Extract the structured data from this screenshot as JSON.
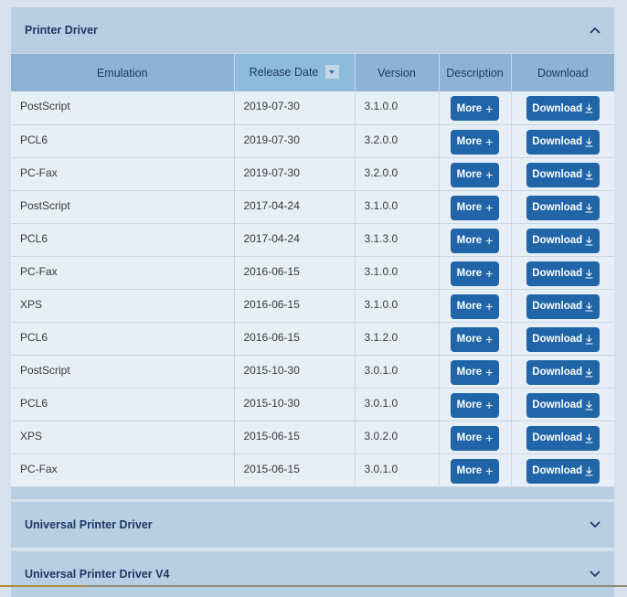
{
  "panels": [
    {
      "title": "Printer Driver",
      "expanded": true,
      "icon": "chevron-up-icon"
    },
    {
      "title": "Universal Printer Driver",
      "expanded": false,
      "icon": "chevron-down-icon"
    },
    {
      "title": "Universal Printer Driver V4",
      "expanded": false,
      "icon": "chevron-down-icon"
    }
  ],
  "table": {
    "columns": [
      "Emulation",
      "Release Date",
      "Version",
      "Description",
      "Download"
    ],
    "sorted_column": "Release Date",
    "sort_direction": "descending",
    "more_label": "More",
    "download_label": "Download",
    "rows": [
      {
        "emulation": "PostScript",
        "date": "2019-07-30",
        "version": "3.1.0.0"
      },
      {
        "emulation": "PCL6",
        "date": "2019-07-30",
        "version": "3.2.0.0"
      },
      {
        "emulation": "PC-Fax",
        "date": "2019-07-30",
        "version": "3.2.0.0"
      },
      {
        "emulation": "PostScript",
        "date": "2017-04-24",
        "version": "3.1.0.0"
      },
      {
        "emulation": "PCL6",
        "date": "2017-04-24",
        "version": "3.1.3.0"
      },
      {
        "emulation": "PC-Fax",
        "date": "2016-06-15",
        "version": "3.1.0.0"
      },
      {
        "emulation": "XPS",
        "date": "2016-06-15",
        "version": "3.1.0.0"
      },
      {
        "emulation": "PCL6",
        "date": "2016-06-15",
        "version": "3.1.2.0"
      },
      {
        "emulation": "PostScript",
        "date": "2015-10-30",
        "version": "3.0.1.0"
      },
      {
        "emulation": "PCL6",
        "date": "2015-10-30",
        "version": "3.0.1.0"
      },
      {
        "emulation": "XPS",
        "date": "2015-06-15",
        "version": "3.0.2.0"
      },
      {
        "emulation": "PC-Fax",
        "date": "2015-06-15",
        "version": "3.0.1.0"
      }
    ]
  },
  "colors": {
    "panel_bg": "#b8cee2",
    "header_bg": "#8eb2d4",
    "button_bg": "#1f65a8",
    "title_text": "#1d3a66"
  }
}
